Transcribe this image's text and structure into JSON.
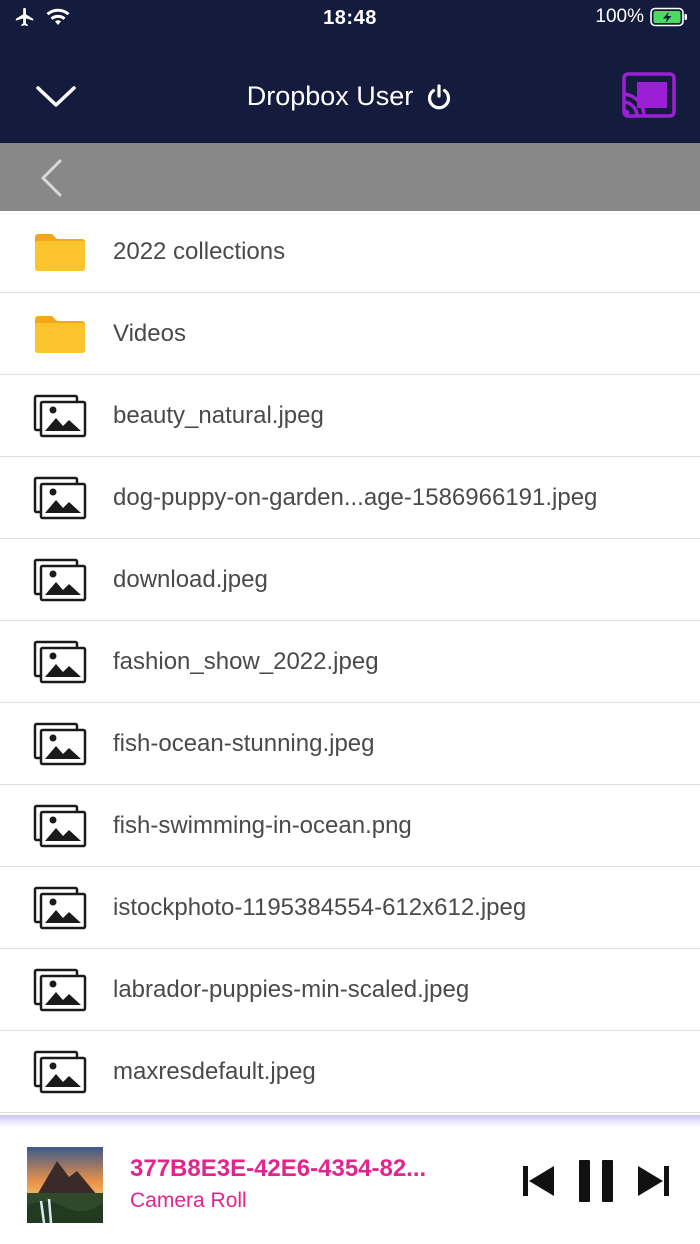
{
  "status_bar": {
    "time": "18:48",
    "battery_percent": "100%"
  },
  "header": {
    "title": "Dropbox User",
    "cast_color": "#9b1fd4"
  },
  "files": [
    {
      "name": "2022 collections",
      "type": "folder"
    },
    {
      "name": "Videos",
      "type": "folder"
    },
    {
      "name": "beauty_natural.jpeg",
      "type": "image"
    },
    {
      "name": "dog-puppy-on-garden...age-1586966191.jpeg",
      "type": "image"
    },
    {
      "name": "download.jpeg",
      "type": "image"
    },
    {
      "name": "fashion_show_2022.jpeg",
      "type": "image"
    },
    {
      "name": "fish-ocean-stunning.jpeg",
      "type": "image"
    },
    {
      "name": "fish-swimming-in-ocean.png",
      "type": "image"
    },
    {
      "name": "istockphoto-1195384554-612x612.jpeg",
      "type": "image"
    },
    {
      "name": "labrador-puppies-min-scaled.jpeg",
      "type": "image"
    },
    {
      "name": "maxresdefault.jpeg",
      "type": "image"
    }
  ],
  "player": {
    "title": "377B8E3E-42E6-4354-82...",
    "subtitle": "Camera Roll"
  },
  "colors": {
    "header_bg": "#131c3d",
    "navbar_bg": "#888888",
    "accent_pink": "#e0258f",
    "folder_yellow": "#fcc42c"
  }
}
